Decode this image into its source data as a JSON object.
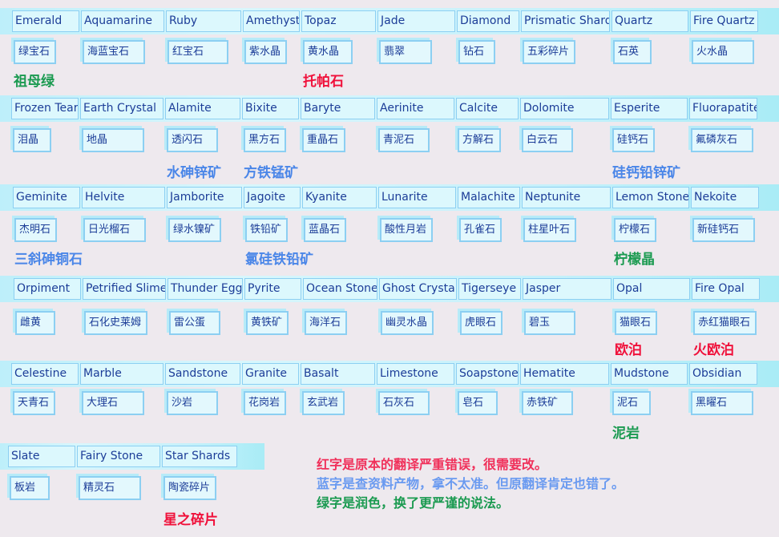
{
  "colors": {
    "red": "#f0103a",
    "blue": "#4a86e8",
    "green": "#1a9a50",
    "legend_red": "#f0305a",
    "legend_blue": "#6a9af0",
    "legend_green": "#1a9a50"
  },
  "rows": [
    {
      "items": [
        {
          "en": "Emerald",
          "cn": "绿宝石",
          "note": "祖母绿",
          "note_color": "green"
        },
        {
          "en": "Aquamarine",
          "cn": "海蓝宝石"
        },
        {
          "en": "Ruby",
          "cn": "红宝石"
        },
        {
          "en": "Amethyst",
          "cn": "紫水晶"
        },
        {
          "en": "Topaz",
          "cn": "黄水晶",
          "note": "托帕石",
          "note_color": "red"
        },
        {
          "en": "Jade",
          "cn": "翡翠"
        },
        {
          "en": "Diamond",
          "cn": "钻石"
        },
        {
          "en": "Prismatic Shard",
          "cn": "五彩碎片"
        },
        {
          "en": "Quartz",
          "cn": "石英"
        },
        {
          "en": "Fire Quartz",
          "cn": "火水晶"
        }
      ]
    },
    {
      "items": [
        {
          "en": "Frozen Tear",
          "cn": "泪晶"
        },
        {
          "en": "Earth Crystal",
          "cn": "地晶"
        },
        {
          "en": "Alamite",
          "cn": "透闪石",
          "note": "水砷锌矿",
          "note_color": "blue"
        },
        {
          "en": "Bixite",
          "cn": "黑方石",
          "note": "方铁锰矿",
          "note_color": "blue"
        },
        {
          "en": "Baryte",
          "cn": "重晶石"
        },
        {
          "en": "Aerinite",
          "cn": "青泥石"
        },
        {
          "en": "Calcite",
          "cn": "方解石"
        },
        {
          "en": "Dolomite",
          "cn": "白云石"
        },
        {
          "en": "Esperite",
          "cn": "硅钙石",
          "note": "硅钙铅锌矿",
          "note_color": "blue"
        },
        {
          "en": "Fluorapatite",
          "cn": "氟磷灰石"
        }
      ]
    },
    {
      "items": [
        {
          "en": "Geminite",
          "cn": "杰明石",
          "note": "三斜砷铜石",
          "note_color": "blue"
        },
        {
          "en": "Helvite",
          "cn": "日光榴石"
        },
        {
          "en": "Jamborite",
          "cn": "绿水镍矿"
        },
        {
          "en": "Jagoite",
          "cn": "铁铅矿",
          "note": "氯硅铁铅矿",
          "note_color": "blue"
        },
        {
          "en": "Kyanite",
          "cn": "蓝晶石"
        },
        {
          "en": "Lunarite",
          "cn": "酸性月岩"
        },
        {
          "en": "Malachite",
          "cn": "孔雀石"
        },
        {
          "en": "Neptunite",
          "cn": "柱星叶石"
        },
        {
          "en": "Lemon Stone",
          "cn": "柠檬石",
          "note": "柠檬晶",
          "note_color": "green"
        },
        {
          "en": "Nekoite",
          "cn": "新硅钙石"
        }
      ]
    },
    {
      "items": [
        {
          "en": "Orpiment",
          "cn": "雌黄"
        },
        {
          "en": "Petrified Slime",
          "cn": "石化史莱姆"
        },
        {
          "en": "Thunder Egg",
          "cn": "雷公蛋"
        },
        {
          "en": "Pyrite",
          "cn": "黄铁矿"
        },
        {
          "en": "Ocean Stone",
          "cn": "海洋石"
        },
        {
          "en": "Ghost Crystal",
          "cn": "幽灵水晶"
        },
        {
          "en": "Tigerseye",
          "cn": "虎眼石"
        },
        {
          "en": "Jasper",
          "cn": "碧玉"
        },
        {
          "en": "Opal",
          "cn": "猫眼石",
          "note": "欧泊",
          "note_color": "red"
        },
        {
          "en": "Fire Opal",
          "cn": "赤红猫眼石",
          "note": "火欧泊",
          "note_color": "red"
        }
      ]
    },
    {
      "items": [
        {
          "en": "Celestine",
          "cn": "天青石"
        },
        {
          "en": "Marble",
          "cn": "大理石"
        },
        {
          "en": "Sandstone",
          "cn": "沙岩"
        },
        {
          "en": "Granite",
          "cn": "花岗岩"
        },
        {
          "en": "Basalt",
          "cn": "玄武岩"
        },
        {
          "en": "Limestone",
          "cn": "石灰石"
        },
        {
          "en": "Soapstone",
          "cn": "皂石"
        },
        {
          "en": "Hematite",
          "cn": "赤铁矿"
        },
        {
          "en": "Mudstone",
          "cn": "泥石",
          "note": "泥岩",
          "note_color": "green"
        },
        {
          "en": "Obsidian",
          "cn": "黑曜石"
        }
      ]
    },
    {
      "items": [
        {
          "en": "Slate",
          "cn": "板岩"
        },
        {
          "en": "Fairy Stone",
          "cn": "精灵石"
        },
        {
          "en": "Star Shards",
          "cn": "陶瓷碎片",
          "note": "星之碎片",
          "note_color": "red"
        }
      ]
    }
  ],
  "legend": {
    "red": "红字是原本的翻译严重错误，很需要改。",
    "blue": "蓝字是查资料产物，拿不太准。但原翻译肯定也错了。",
    "green": "绿字是润色，换了更严谨的说法。"
  }
}
